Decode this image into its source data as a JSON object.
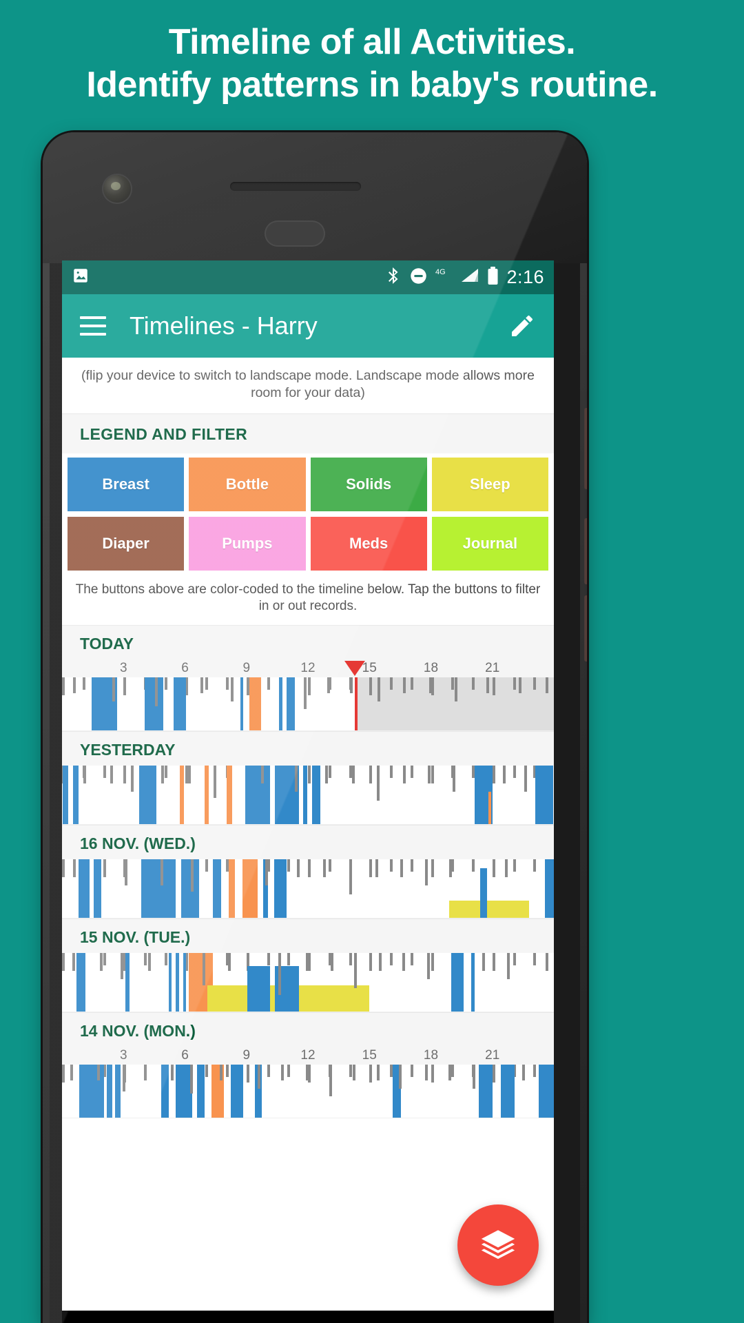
{
  "promo": {
    "line1": "Timeline of all Activities.",
    "line2": "Identify patterns in baby's routine.",
    "bg_color": "#0d9488",
    "text_color": "#ffffff"
  },
  "statusbar": {
    "time": "2:16",
    "icons": [
      "image-icon",
      "bluetooth-icon",
      "do-not-disturb-icon",
      "network-4g-icon",
      "signal-icon",
      "battery-icon"
    ],
    "network_label": "4G",
    "bg_color": "#0b6b5e"
  },
  "appbar": {
    "title": "Timelines - Harry",
    "menu_icon": "hamburger-menu-icon",
    "action_icon": "edit-pencil-icon",
    "bg_color": "#17a395"
  },
  "hint": "(flip your device to switch to landscape mode. Landscape mode allows more room for your data)",
  "legend": {
    "heading": "LEGEND AND FILTER",
    "note": "The buttons above are color-coded to the timeline below. Tap the buttons to filter in or out records.",
    "items": [
      {
        "label": "Breast",
        "color": "#3289c9"
      },
      {
        "label": "Bottle",
        "color": "#f8934f"
      },
      {
        "label": "Solids",
        "color": "#3cab45"
      },
      {
        "label": "Sleep",
        "color": "#e8e047"
      },
      {
        "label": "Diaper",
        "color": "#9a5f48"
      },
      {
        "label": "Pumps",
        "color": "#fa9fe0"
      },
      {
        "label": "Meds",
        "color": "#f9534a"
      },
      {
        "label": "Journal",
        "color": "#b7f132"
      }
    ]
  },
  "timeline": {
    "hour_labels": [
      "3",
      "6",
      "9",
      "12",
      "15",
      "18",
      "21"
    ],
    "axis_min_hour": 0,
    "axis_max_hour": 24,
    "now_hour": 14.3,
    "future_shading_color": "#dedede",
    "now_marker_color": "#e53935",
    "days": [
      {
        "label": "TODAY",
        "show_ruler": true,
        "show_now": true,
        "events": [
          {
            "type": "Diaper",
            "start": 0.55,
            "end": 0.62,
            "h": 0.3
          },
          {
            "type": "Breast",
            "start": 1.45,
            "end": 2.7,
            "h": 1.0
          },
          {
            "type": "Diaper",
            "start": 2.45,
            "end": 2.52,
            "h": 0.45
          },
          {
            "type": "Breast",
            "start": 4.05,
            "end": 4.95,
            "h": 1.0
          },
          {
            "type": "Diaper",
            "start": 4.55,
            "end": 4.62,
            "h": 0.55
          },
          {
            "type": "Breast",
            "start": 5.45,
            "end": 6.05,
            "h": 1.0
          },
          {
            "type": "Diaper",
            "start": 6.75,
            "end": 6.82,
            "h": 0.3
          },
          {
            "type": "Diaper",
            "start": 8.25,
            "end": 8.32,
            "h": 0.45
          },
          {
            "type": "Breast",
            "start": 8.7,
            "end": 8.85,
            "h": 1.0
          },
          {
            "type": "Bottle",
            "start": 9.15,
            "end": 9.7,
            "h": 1.0
          },
          {
            "type": "Breast",
            "start": 10.6,
            "end": 10.75,
            "h": 1.0
          },
          {
            "type": "Breast",
            "start": 10.95,
            "end": 11.35,
            "h": 1.0
          },
          {
            "type": "Diaper",
            "start": 11.8,
            "end": 11.87,
            "h": 0.6
          },
          {
            "type": "Diaper",
            "start": 12.95,
            "end": 13.02,
            "h": 0.3
          },
          {
            "type": "Diaper",
            "start": 14.05,
            "end": 14.12,
            "h": 0.3
          },
          {
            "type": "Diaper",
            "start": 15.4,
            "end": 15.47,
            "h": 0.45
          },
          {
            "type": "Diaper",
            "start": 16.65,
            "end": 16.72,
            "h": 0.3
          },
          {
            "type": "Diaper",
            "start": 17.9,
            "end": 17.97,
            "h": 0.3
          },
          {
            "type": "Diaper",
            "start": 19.15,
            "end": 19.22,
            "h": 0.45
          },
          {
            "type": "Diaper",
            "start": 20.7,
            "end": 20.77,
            "h": 0.3
          },
          {
            "type": "Diaper",
            "start": 22.3,
            "end": 22.37,
            "h": 0.3
          },
          {
            "type": "Diaper",
            "start": 23.6,
            "end": 23.67,
            "h": 0.3
          }
        ]
      },
      {
        "label": "YESTERDAY",
        "show_ruler": false,
        "show_now": false,
        "events": [
          {
            "type": "Breast",
            "start": 0.05,
            "end": 0.3,
            "h": 1.0
          },
          {
            "type": "Breast",
            "start": 0.55,
            "end": 0.8,
            "h": 1.0
          },
          {
            "type": "Diaper",
            "start": 1.05,
            "end": 1.12,
            "h": 0.3
          },
          {
            "type": "Diaper",
            "start": 2.35,
            "end": 2.42,
            "h": 0.3
          },
          {
            "type": "Diaper",
            "start": 3.35,
            "end": 3.42,
            "h": 0.45
          },
          {
            "type": "Breast",
            "start": 3.75,
            "end": 4.6,
            "h": 1.0
          },
          {
            "type": "Diaper",
            "start": 4.85,
            "end": 4.92,
            "h": 0.3
          },
          {
            "type": "Bottle",
            "start": 5.75,
            "end": 5.95,
            "h": 1.0
          },
          {
            "type": "Diaper",
            "start": 6.15,
            "end": 6.22,
            "h": 0.3
          },
          {
            "type": "Bottle",
            "start": 6.95,
            "end": 7.15,
            "h": 1.0
          },
          {
            "type": "Diaper",
            "start": 7.4,
            "end": 7.47,
            "h": 0.55
          },
          {
            "type": "Bottle",
            "start": 8.05,
            "end": 8.3,
            "h": 1.0
          },
          {
            "type": "Breast",
            "start": 8.95,
            "end": 10.15,
            "h": 1.0
          },
          {
            "type": "Diaper",
            "start": 9.7,
            "end": 9.77,
            "h": 0.3
          },
          {
            "type": "Breast",
            "start": 10.4,
            "end": 11.55,
            "h": 1.0
          },
          {
            "type": "Diaper",
            "start": 11.35,
            "end": 11.42,
            "h": 0.45
          },
          {
            "type": "Breast",
            "start": 11.75,
            "end": 11.95,
            "h": 1.0
          },
          {
            "type": "Breast",
            "start": 12.2,
            "end": 12.6,
            "h": 1.0
          },
          {
            "type": "Diaper",
            "start": 12.85,
            "end": 12.92,
            "h": 0.3
          },
          {
            "type": "Diaper",
            "start": 14.15,
            "end": 14.22,
            "h": 0.3
          },
          {
            "type": "Diaper",
            "start": 15.35,
            "end": 15.42,
            "h": 0.6
          },
          {
            "type": "Diaper",
            "start": 16.65,
            "end": 16.72,
            "h": 0.3
          },
          {
            "type": "Diaper",
            "start": 17.85,
            "end": 17.92,
            "h": 0.3
          },
          {
            "type": "Diaper",
            "start": 19.05,
            "end": 19.12,
            "h": 0.45
          },
          {
            "type": "Breast",
            "start": 20.15,
            "end": 21.0,
            "h": 1.0
          },
          {
            "type": "Bottle",
            "start": 20.8,
            "end": 20.88,
            "h": 0.55
          },
          {
            "type": "Diaper",
            "start": 21.5,
            "end": 21.57,
            "h": 0.3
          },
          {
            "type": "Diaper",
            "start": 22.55,
            "end": 22.62,
            "h": 0.45
          },
          {
            "type": "Breast",
            "start": 23.1,
            "end": 23.95,
            "h": 1.0
          }
        ]
      },
      {
        "label": "16 NOV. (WED.)",
        "show_ruler": false,
        "show_now": false,
        "events": [
          {
            "type": "Diaper",
            "start": 0.55,
            "end": 0.62,
            "h": 0.3
          },
          {
            "type": "Breast",
            "start": 0.8,
            "end": 1.35,
            "h": 1.0
          },
          {
            "type": "Breast",
            "start": 1.55,
            "end": 1.9,
            "h": 1.0
          },
          {
            "type": "Diaper",
            "start": 2.0,
            "end": 2.07,
            "h": 0.3
          },
          {
            "type": "Diaper",
            "start": 3.05,
            "end": 3.12,
            "h": 0.45
          },
          {
            "type": "Breast",
            "start": 3.85,
            "end": 5.55,
            "h": 1.0
          },
          {
            "type": "Diaper",
            "start": 4.8,
            "end": 4.87,
            "h": 0.45
          },
          {
            "type": "Breast",
            "start": 5.8,
            "end": 6.7,
            "h": 1.0
          },
          {
            "type": "Diaper",
            "start": 6.3,
            "end": 6.37,
            "h": 0.55
          },
          {
            "type": "Breast",
            "start": 7.35,
            "end": 7.75,
            "h": 1.0
          },
          {
            "type": "Bottle",
            "start": 8.15,
            "end": 8.45,
            "h": 1.0
          },
          {
            "type": "Bottle",
            "start": 8.8,
            "end": 9.55,
            "h": 1.0
          },
          {
            "type": "Breast",
            "start": 9.8,
            "end": 10.05,
            "h": 1.0
          },
          {
            "type": "Diaper",
            "start": 9.9,
            "end": 9.97,
            "h": 0.45
          },
          {
            "type": "Breast",
            "start": 10.35,
            "end": 10.95,
            "h": 1.0
          },
          {
            "type": "Diaper",
            "start": 11.45,
            "end": 11.52,
            "h": 0.3
          },
          {
            "type": "Diaper",
            "start": 12.75,
            "end": 12.82,
            "h": 0.3
          },
          {
            "type": "Diaper",
            "start": 14.0,
            "end": 14.07,
            "h": 0.6
          },
          {
            "type": "Diaper",
            "start": 15.3,
            "end": 15.37,
            "h": 0.3
          },
          {
            "type": "Diaper",
            "start": 16.5,
            "end": 16.57,
            "h": 0.3
          },
          {
            "type": "Diaper",
            "start": 17.7,
            "end": 17.77,
            "h": 0.45
          },
          {
            "type": "Diaper",
            "start": 18.9,
            "end": 18.97,
            "h": 0.3
          },
          {
            "type": "Sleep",
            "start": 18.9,
            "end": 22.8,
            "h": 0.3
          },
          {
            "type": "Breast",
            "start": 20.4,
            "end": 20.75,
            "h": 0.85
          },
          {
            "type": "Diaper",
            "start": 21.6,
            "end": 21.67,
            "h": 0.3
          },
          {
            "type": "Breast",
            "start": 23.55,
            "end": 24.0,
            "h": 1.0
          }
        ]
      },
      {
        "label": "15 NOV. (TUE.)",
        "show_ruler": false,
        "show_now": false,
        "events": [
          {
            "type": "Diaper",
            "start": 0.5,
            "end": 0.57,
            "h": 0.3
          },
          {
            "type": "Breast",
            "start": 0.7,
            "end": 1.15,
            "h": 1.0
          },
          {
            "type": "Diaper",
            "start": 1.85,
            "end": 1.92,
            "h": 0.3
          },
          {
            "type": "Diaper",
            "start": 2.85,
            "end": 2.92,
            "h": 0.45
          },
          {
            "type": "Breast",
            "start": 3.1,
            "end": 3.3,
            "h": 1.0
          },
          {
            "type": "Diaper",
            "start": 4.2,
            "end": 4.27,
            "h": 0.3
          },
          {
            "type": "Breast",
            "start": 5.2,
            "end": 5.35,
            "h": 1.0
          },
          {
            "type": "Breast",
            "start": 5.55,
            "end": 5.7,
            "h": 1.0
          },
          {
            "type": "Breast",
            "start": 5.9,
            "end": 6.05,
            "h": 1.0
          },
          {
            "type": "Bottle",
            "start": 6.2,
            "end": 7.35,
            "h": 1.0
          },
          {
            "type": "Diaper",
            "start": 6.85,
            "end": 6.92,
            "h": 0.55
          },
          {
            "type": "Sleep",
            "start": 7.1,
            "end": 15.0,
            "h": 0.45
          },
          {
            "type": "Diaper",
            "start": 8.1,
            "end": 8.17,
            "h": 0.3
          },
          {
            "type": "Breast",
            "start": 9.05,
            "end": 10.15,
            "h": 0.78
          },
          {
            "type": "Breast",
            "start": 10.4,
            "end": 11.55,
            "h": 0.78
          },
          {
            "type": "Diaper",
            "start": 10.55,
            "end": 10.62,
            "h": 0.72
          },
          {
            "type": "Diaper",
            "start": 11.9,
            "end": 11.97,
            "h": 0.3
          },
          {
            "type": "Diaper",
            "start": 13.1,
            "end": 13.17,
            "h": 0.3
          },
          {
            "type": "Diaper",
            "start": 14.25,
            "end": 14.32,
            "h": 0.6
          },
          {
            "type": "Diaper",
            "start": 15.45,
            "end": 15.52,
            "h": 0.3
          },
          {
            "type": "Diaper",
            "start": 16.6,
            "end": 16.67,
            "h": 0.3
          },
          {
            "type": "Diaper",
            "start": 17.8,
            "end": 17.87,
            "h": 0.45
          },
          {
            "type": "Breast",
            "start": 19.0,
            "end": 19.6,
            "h": 1.0
          },
          {
            "type": "Breast",
            "start": 19.95,
            "end": 20.15,
            "h": 1.0
          },
          {
            "type": "Diaper",
            "start": 20.5,
            "end": 20.57,
            "h": 0.3
          },
          {
            "type": "Diaper",
            "start": 21.7,
            "end": 21.77,
            "h": 0.45
          },
          {
            "type": "Diaper",
            "start": 23.6,
            "end": 23.67,
            "h": 0.3
          }
        ]
      },
      {
        "label": "14 NOV. (MON.)",
        "show_ruler": true,
        "show_now": false,
        "events": [
          {
            "type": "Diaper",
            "start": 0.4,
            "end": 0.47,
            "h": 0.3
          },
          {
            "type": "Breast",
            "start": 0.85,
            "end": 2.05,
            "h": 1.0
          },
          {
            "type": "Diaper",
            "start": 1.7,
            "end": 1.77,
            "h": 0.3
          },
          {
            "type": "Breast",
            "start": 2.2,
            "end": 2.45,
            "h": 1.0
          },
          {
            "type": "Breast",
            "start": 2.6,
            "end": 2.85,
            "h": 1.0
          },
          {
            "type": "Diaper",
            "start": 2.95,
            "end": 3.02,
            "h": 0.5
          },
          {
            "type": "Diaper",
            "start": 4.0,
            "end": 4.07,
            "h": 0.3
          },
          {
            "type": "Breast",
            "start": 4.85,
            "end": 5.2,
            "h": 1.0
          },
          {
            "type": "Diaper",
            "start": 5.3,
            "end": 5.37,
            "h": 0.3
          },
          {
            "type": "Breast",
            "start": 5.55,
            "end": 6.35,
            "h": 1.0
          },
          {
            "type": "Diaper",
            "start": 6.25,
            "end": 6.32,
            "h": 0.55
          },
          {
            "type": "Breast",
            "start": 6.6,
            "end": 6.95,
            "h": 1.0
          },
          {
            "type": "Bottle",
            "start": 7.3,
            "end": 7.9,
            "h": 1.0
          },
          {
            "type": "Diaper",
            "start": 7.7,
            "end": 7.77,
            "h": 0.3
          },
          {
            "type": "Breast",
            "start": 8.25,
            "end": 8.85,
            "h": 1.0
          },
          {
            "type": "Breast",
            "start": 9.4,
            "end": 9.75,
            "h": 1.0
          },
          {
            "type": "Diaper",
            "start": 9.55,
            "end": 9.62,
            "h": 0.45
          },
          {
            "type": "Diaper",
            "start": 10.7,
            "end": 10.77,
            "h": 0.3
          },
          {
            "type": "Diaper",
            "start": 11.9,
            "end": 11.97,
            "h": 0.3
          },
          {
            "type": "Diaper",
            "start": 13.05,
            "end": 13.12,
            "h": 0.6
          },
          {
            "type": "Diaper",
            "start": 14.2,
            "end": 14.27,
            "h": 0.3
          },
          {
            "type": "Diaper",
            "start": 15.35,
            "end": 15.42,
            "h": 0.3
          },
          {
            "type": "Breast",
            "start": 16.15,
            "end": 16.55,
            "h": 1.0
          },
          {
            "type": "Diaper",
            "start": 16.45,
            "end": 16.52,
            "h": 0.45
          },
          {
            "type": "Diaper",
            "start": 17.7,
            "end": 17.77,
            "h": 0.3
          },
          {
            "type": "Diaper",
            "start": 18.85,
            "end": 18.92,
            "h": 0.3
          },
          {
            "type": "Diaper",
            "start": 20.05,
            "end": 20.12,
            "h": 0.45
          },
          {
            "type": "Breast",
            "start": 20.35,
            "end": 21.0,
            "h": 1.0
          },
          {
            "type": "Breast",
            "start": 21.4,
            "end": 22.1,
            "h": 1.0
          },
          {
            "type": "Diaper",
            "start": 22.45,
            "end": 22.52,
            "h": 0.3
          },
          {
            "type": "Breast",
            "start": 23.25,
            "end": 24.0,
            "h": 1.0
          }
        ]
      }
    ]
  },
  "fab": {
    "icon": "layers-icon",
    "color": "#f4473b"
  }
}
